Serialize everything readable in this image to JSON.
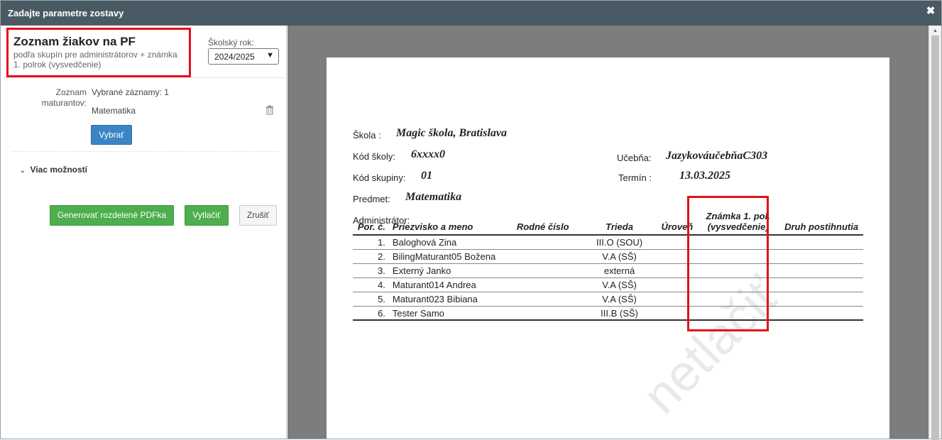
{
  "dialog": {
    "title": "Zadajte parametre zostavy",
    "close_icon": "close-icon"
  },
  "left": {
    "report_title": "Zoznam žiakov na PF",
    "report_subtitle": "podľa skupín pre administrátorov + známka 1. polrok (vysvedčenie)",
    "year_label": "Školský rok:",
    "year_value": "2024/2025",
    "maturanti_label": "Zoznam maturantov:",
    "selected_count": "Vybrané záznamy: 1",
    "selected_item": "Matematika",
    "select_button": "Vybrať",
    "more_options": "Viac možností",
    "btn_pdf": "Generovať rozdelené PDFka",
    "btn_print": "Vytlačiť",
    "btn_cancel": "Zrušiť"
  },
  "report": {
    "school_label": "Škola :",
    "school_value": "Magic škola, Bratislava",
    "code_label": "Kód školy:",
    "code_value": "6xxxx0",
    "room_label": "Učebňa:",
    "room_value": "JazykováučebňaC303",
    "group_label": "Kód skupiny:",
    "group_value": "01",
    "term_label": "Termín :",
    "term_value": "13.03.2025",
    "subject_label": "Predmet:",
    "subject_value": "Matematika",
    "admin_label": "Administrátor:",
    "watermark": "netlačiť",
    "columns": [
      "Por. č.",
      "Priezvisko a meno",
      "Rodné číslo",
      "Trieda",
      "Úroveň",
      "Známka 1. pol. (vysvedčenie)",
      "Druh postihnutia"
    ],
    "rows": [
      {
        "num": "1.",
        "name": "Baloghová Zina",
        "rc": "",
        "class": "III.O (SOU)",
        "level": "",
        "grade": "",
        "dis": ""
      },
      {
        "num": "2.",
        "name": "BilingMaturant05 Božena",
        "rc": "",
        "class": "V.A (SŠ)",
        "level": "",
        "grade": "",
        "dis": ""
      },
      {
        "num": "3.",
        "name": "Externý Janko",
        "rc": "",
        "class": "externá",
        "level": "",
        "grade": "",
        "dis": ""
      },
      {
        "num": "4.",
        "name": "Maturant014 Andrea",
        "rc": "",
        "class": "V.A (SŠ)",
        "level": "",
        "grade": "",
        "dis": ""
      },
      {
        "num": "5.",
        "name": "Maturant023 Bibiana",
        "rc": "",
        "class": "V.A (SŠ)",
        "level": "",
        "grade": "",
        "dis": ""
      },
      {
        "num": "6.",
        "name": "Tester Samo",
        "rc": "",
        "class": "III.B (SŠ)",
        "level": "",
        "grade": "",
        "dis": ""
      }
    ]
  }
}
